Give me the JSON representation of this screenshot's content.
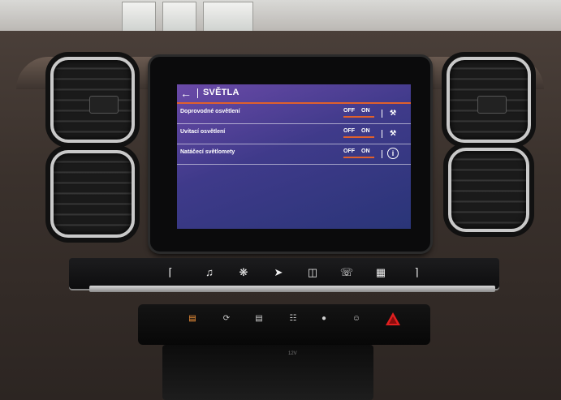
{
  "screen": {
    "title": "SVĚTLA",
    "back_icon": "back-arrow-icon",
    "accent_color": "#e0602c",
    "rows": [
      {
        "label": "Doprovodné osvětlení",
        "off": "OFF",
        "on": "ON",
        "selected": "ON",
        "icon": "wrench-icon"
      },
      {
        "label": "Uvítací osvětlení",
        "off": "OFF",
        "on": "ON",
        "selected": "ON",
        "icon": "wrench-icon"
      },
      {
        "label": "Natáčecí světlomety",
        "off": "OFF",
        "on": "ON",
        "selected": "ON",
        "icon": "info-icon"
      }
    ]
  },
  "console": {
    "touch_controls": [
      "climate-seat-icon",
      "music-note-icon",
      "fan-icon",
      "navigation-icon",
      "car-icon",
      "phone-icon",
      "apps-grid-icon",
      "seat-heat-icon"
    ],
    "lower_buttons": [
      "rear-defrost-icon",
      "recirculation-icon",
      "front-defrost-icon",
      "heated-screen-icon",
      "lock-icon",
      "airbag-icon"
    ],
    "tray_label": "12V"
  }
}
